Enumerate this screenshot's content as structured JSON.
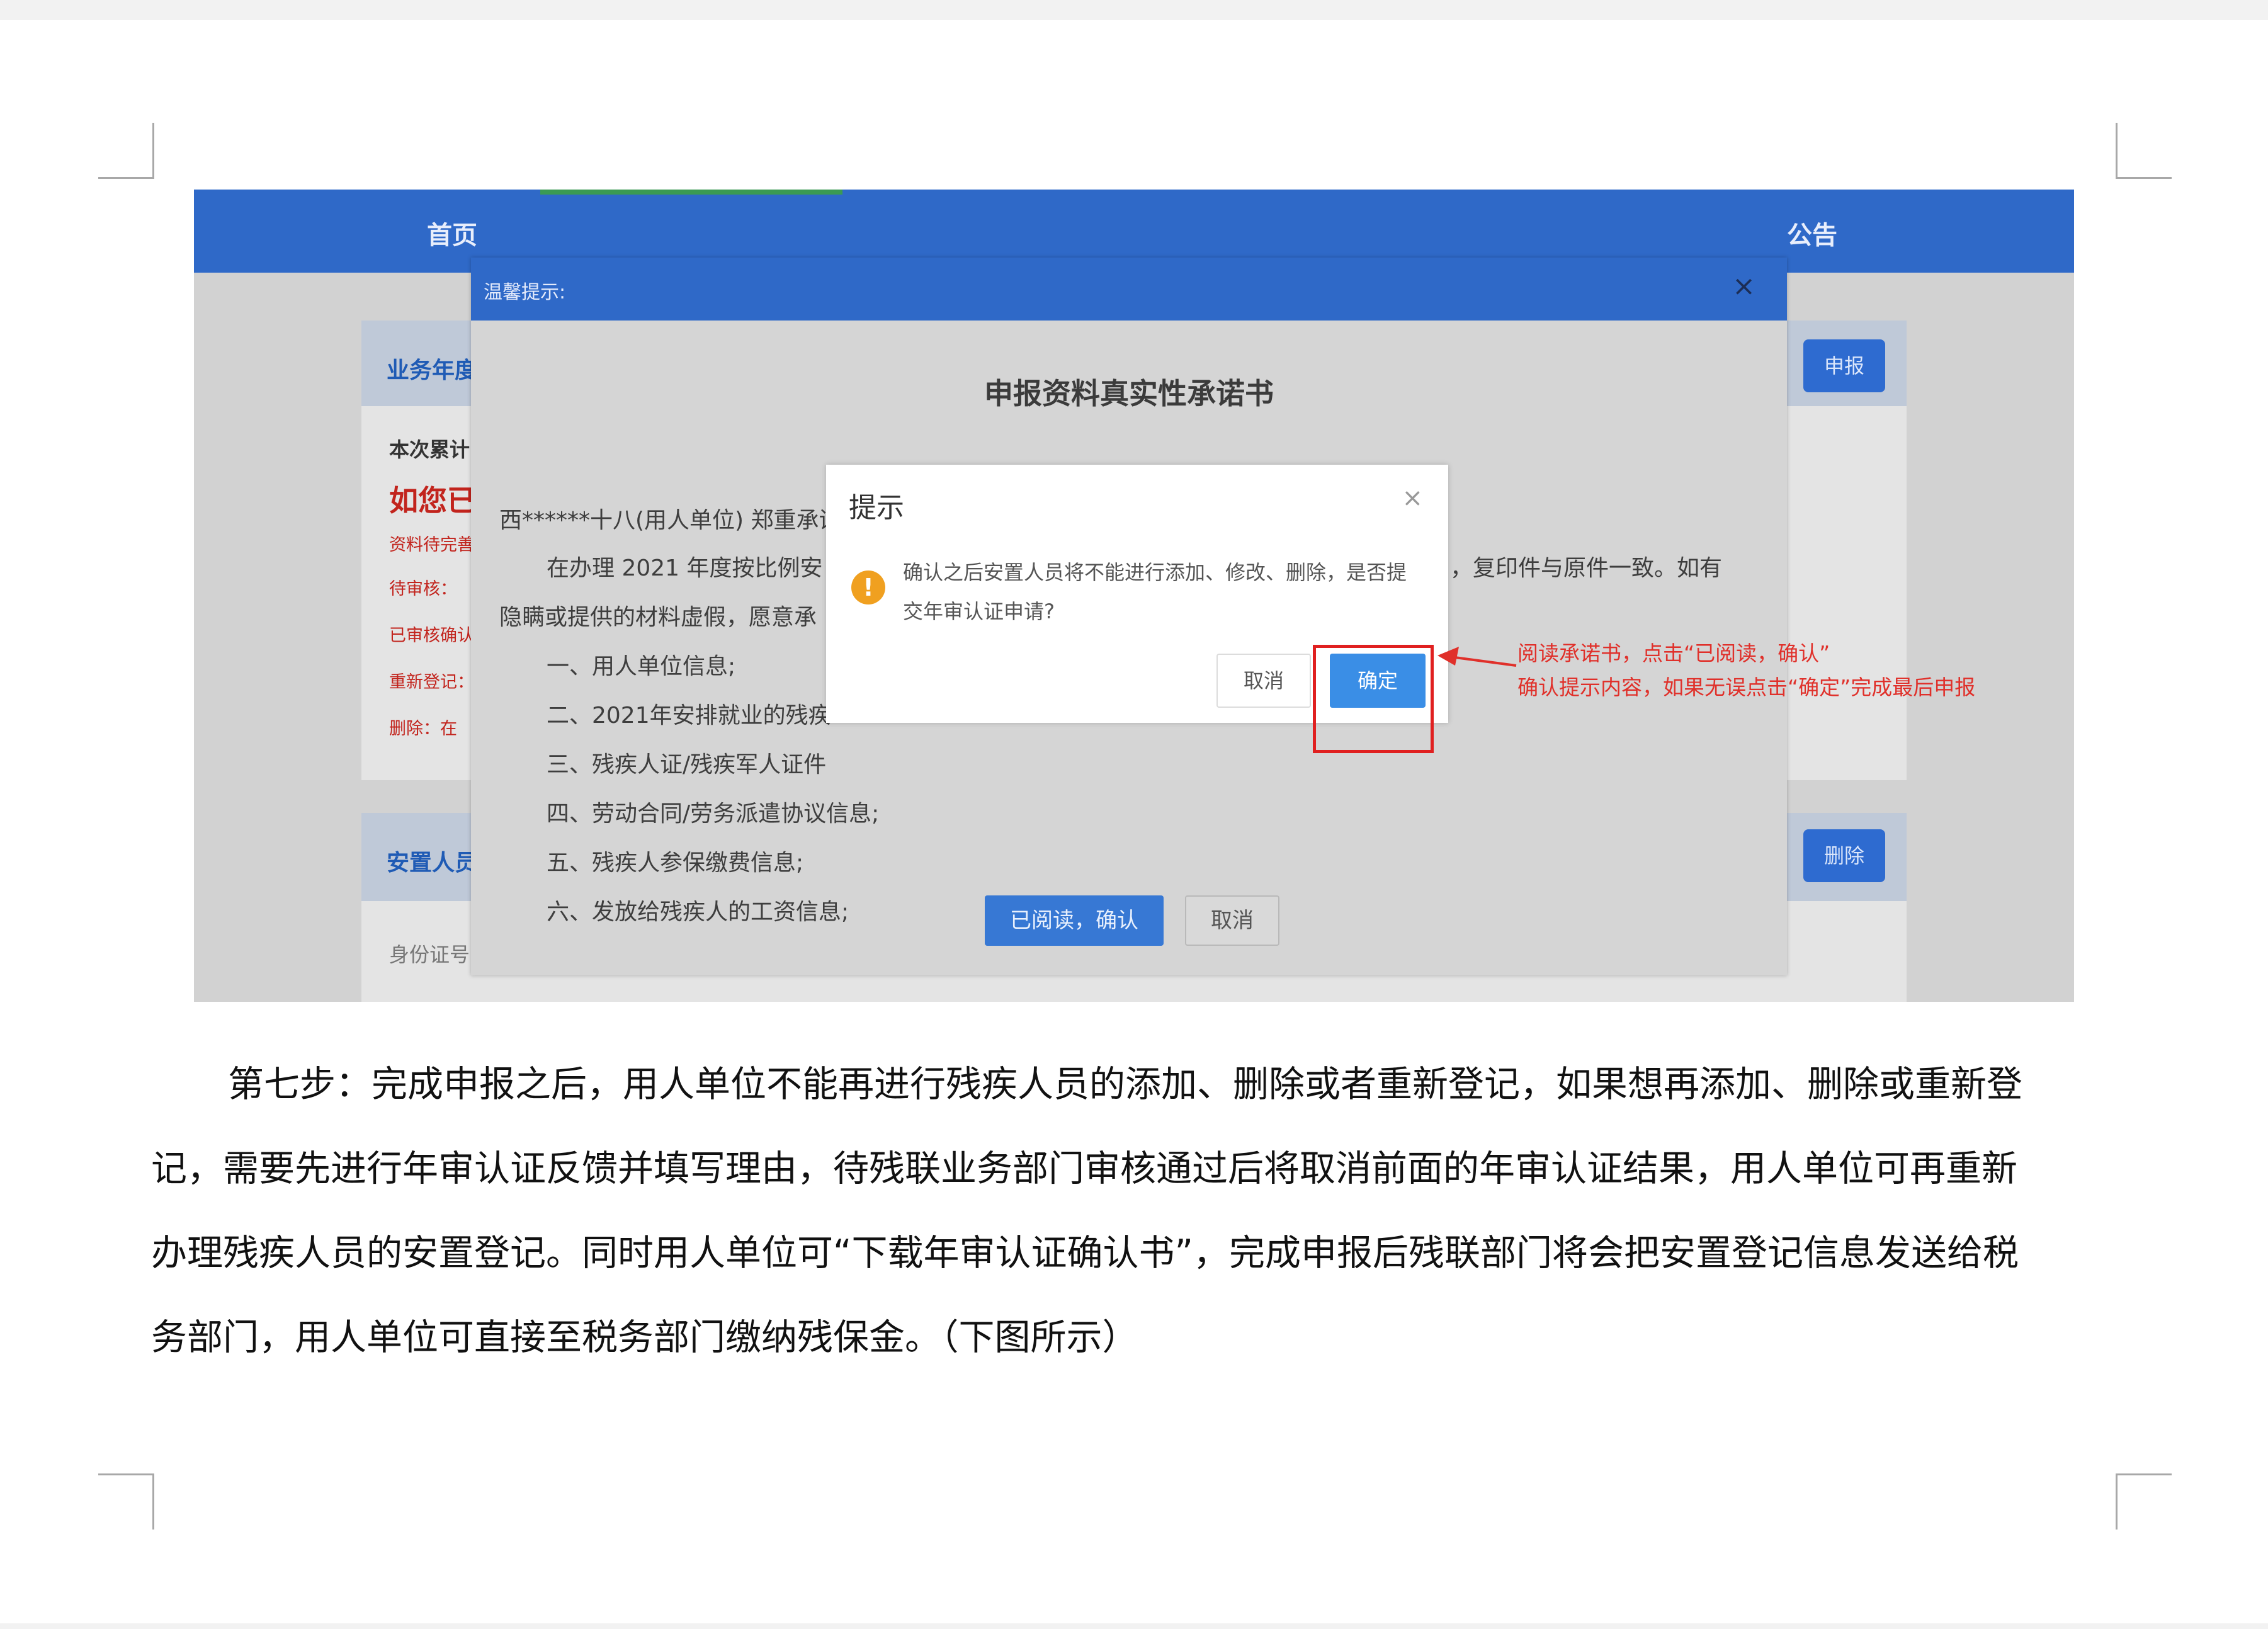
{
  "screenshot": {
    "nav": {
      "home": "首页",
      "notice": "公告"
    },
    "bg": {
      "card1_title": "业务年度",
      "card1_btn": "申报",
      "line_cumulative": "本次累计",
      "line_if": "如您已",
      "line_pending_info": "资料待完善",
      "line_pending_review": "待审核：",
      "line_confirmed": "已审核确认",
      "line_reregister": "重新登记：",
      "line_delete": "删除：在",
      "card2_title": "安置人员",
      "card2_btn": "删除",
      "id_label": "身份证号"
    },
    "outer_modal": {
      "header": "温馨提示:",
      "close": "×",
      "title": "申报资料真实性承诺书",
      "lines": [
        "西******十八(用人单位) 郑重承诺:",
        "在办理 2021 年度按比例安",
        "隐瞒或提供的材料虚假，愿意承",
        "一、用人单位信息;",
        "二、2021年安排就业的残疾",
        "三、残疾人证/残疾军人证件",
        "四、劳动合同/劳务派遣协议信息;",
        "五、残疾人参保缴费信息;",
        "六、发放给残疾人的工资信息;"
      ],
      "line_tail": "，复印件与原件一致。如有",
      "confirm_btn": "已阅读，确认",
      "cancel_btn": "取消"
    },
    "alert": {
      "title": "提示",
      "close": "×",
      "icon": "!",
      "message": "确认之后安置人员将不能进行添加、修改、删除，是否提交年审认证申请?",
      "cancel": "取消",
      "ok": "确定"
    },
    "annotation": {
      "line1": "阅读承诺书，点击“已阅读，确认”",
      "line2": "确认提示内容，如果无误点击“确定”完成最后申报"
    }
  },
  "paragraph": {
    "lines": [
      "第七步：完成申报之后，用人单位不能再进行残疾人员的添加、删除或者重新登记，如果想再添加、删除或重新登",
      "记，需要先进行年审认证反馈并填写理由，待残联业务部门审核通过后将取消前面的年审认证结果，用人单位可再重新",
      "办理残疾人员的安置登记。同时用人单位可“下载年审认证确认书”，完成申报后残联部门将会把安置登记信息发送给税",
      "务部门，用人单位可直接至税务部门缴纳残保金。（下图所示）"
    ]
  },
  "colors": {
    "nav_blue": "#2f69c8",
    "annotation_red": "#e0302a",
    "ok_blue": "#3a8ee6",
    "warn_orange": "#f0a020"
  }
}
